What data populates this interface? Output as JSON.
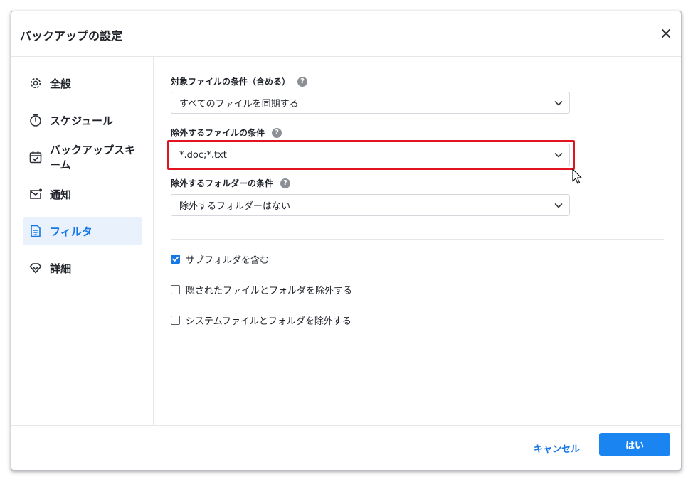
{
  "dialog": {
    "title": "バックアップの設定"
  },
  "sidebar": {
    "items": [
      {
        "label": "全般",
        "icon": "gear-icon"
      },
      {
        "label": "スケジュール",
        "icon": "timer-icon"
      },
      {
        "label": "バックアップスキーム",
        "icon": "calendar-check-icon"
      },
      {
        "label": "通知",
        "icon": "mail-notification-icon"
      },
      {
        "label": "フィルタ",
        "icon": "filter-document-icon",
        "active": true
      },
      {
        "label": "詳細",
        "icon": "diamond-icon"
      }
    ]
  },
  "filter": {
    "include_label": "対象ファイルの条件（含める）",
    "include_value": "すべてのファイルを同期する",
    "exclude_label": "除外するファイルの条件",
    "exclude_value": "*.doc;*.txt",
    "exclude_folder_label": "除外するフォルダーの条件",
    "exclude_folder_value": "除外するフォルダーはない",
    "help_glyph": "?",
    "options": [
      {
        "label": "サブフォルダを含む",
        "checked": true
      },
      {
        "label": "隠されたファイルとフォルダを除外する",
        "checked": false
      },
      {
        "label": "システムファイルとフォルダを除外する",
        "checked": false
      }
    ]
  },
  "footer": {
    "cancel_label": "キャンセル",
    "ok_label": "はい"
  },
  "colors": {
    "accent": "#1677e6",
    "highlight": "#e0151f",
    "active_bg": "#e8f1fc"
  }
}
